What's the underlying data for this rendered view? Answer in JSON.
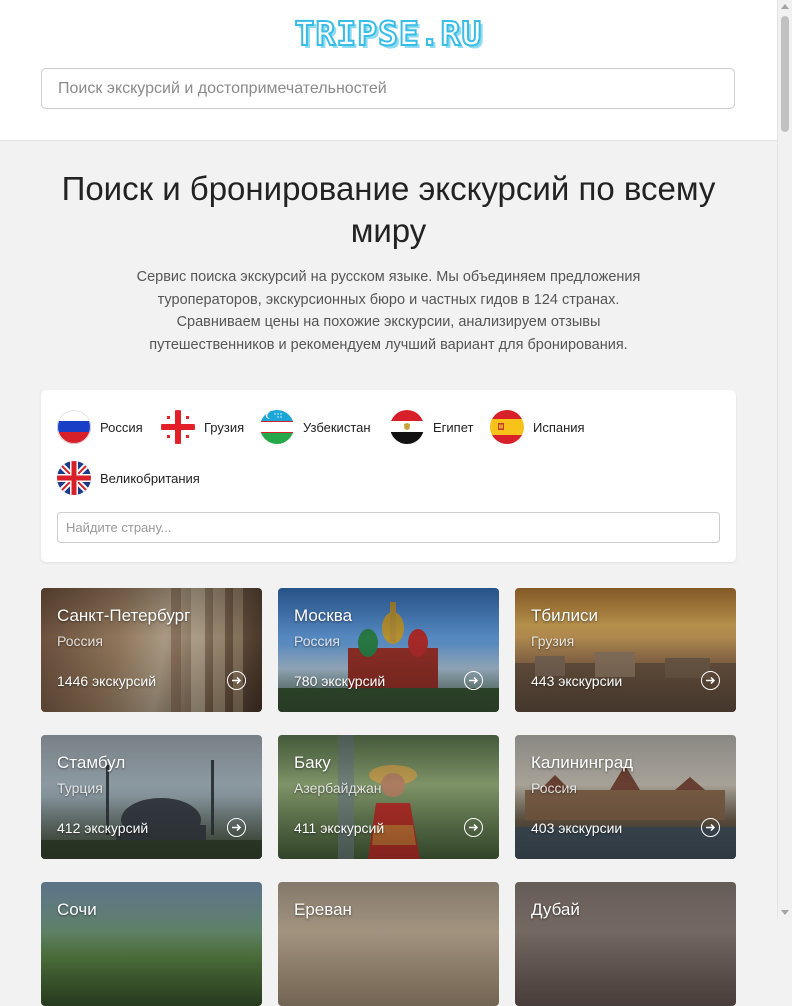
{
  "header": {
    "logo": "TRIPSE.RU",
    "search_placeholder": "Поиск экскурсий и достопримечательностей"
  },
  "hero": {
    "title": "Поиск и бронирование экскурсий по всему миру",
    "description": "Сервис поиска экскурсий на русском языке. Мы объединяем предложения туроператоров, экскурсионных бюро и частных гидов в 124 странах. Сравниваем цены на похожие экскурсии, анализируем отзывы путешественников и рекомендуем лучший вариант для бронирования."
  },
  "countries": {
    "items": [
      {
        "label": "Россия",
        "icon": "russia-flag-icon"
      },
      {
        "label": "Грузия",
        "icon": "georgia-flag-icon"
      },
      {
        "label": "Узбекистан",
        "icon": "uzbekistan-flag-icon"
      },
      {
        "label": "Египет",
        "icon": "egypt-flag-icon"
      },
      {
        "label": "Испания",
        "icon": "spain-flag-icon"
      },
      {
        "label": "Великобритания",
        "icon": "uk-flag-icon"
      }
    ],
    "search_placeholder": "Найдите страну..."
  },
  "cities": [
    {
      "name": "Санкт-Петербург",
      "country": "Россия",
      "count": "1446 экскурсий",
      "icon": "arrow-right-circle-icon"
    },
    {
      "name": "Москва",
      "country": "Россия",
      "count": "780 экскурсий",
      "icon": "arrow-right-circle-icon"
    },
    {
      "name": "Тбилиси",
      "country": "Грузия",
      "count": "443 экскурсии",
      "icon": "arrow-right-circle-icon"
    },
    {
      "name": "Стамбул",
      "country": "Турция",
      "count": "412 экскурсий",
      "icon": "arrow-right-circle-icon"
    },
    {
      "name": "Баку",
      "country": "Азербайджан",
      "count": "411 экскурсий",
      "icon": "arrow-right-circle-icon"
    },
    {
      "name": "Калининград",
      "country": "Россия",
      "count": "403 экскурсии",
      "icon": "arrow-right-circle-icon"
    },
    {
      "name": "Сочи",
      "country": "",
      "count": "",
      "icon": ""
    },
    {
      "name": "Ереван",
      "country": "",
      "count": "",
      "icon": ""
    },
    {
      "name": "Дубай",
      "country": "",
      "count": "",
      "icon": ""
    }
  ],
  "colors": {
    "logo": "#38bde6",
    "background": "#f2f2f2"
  }
}
